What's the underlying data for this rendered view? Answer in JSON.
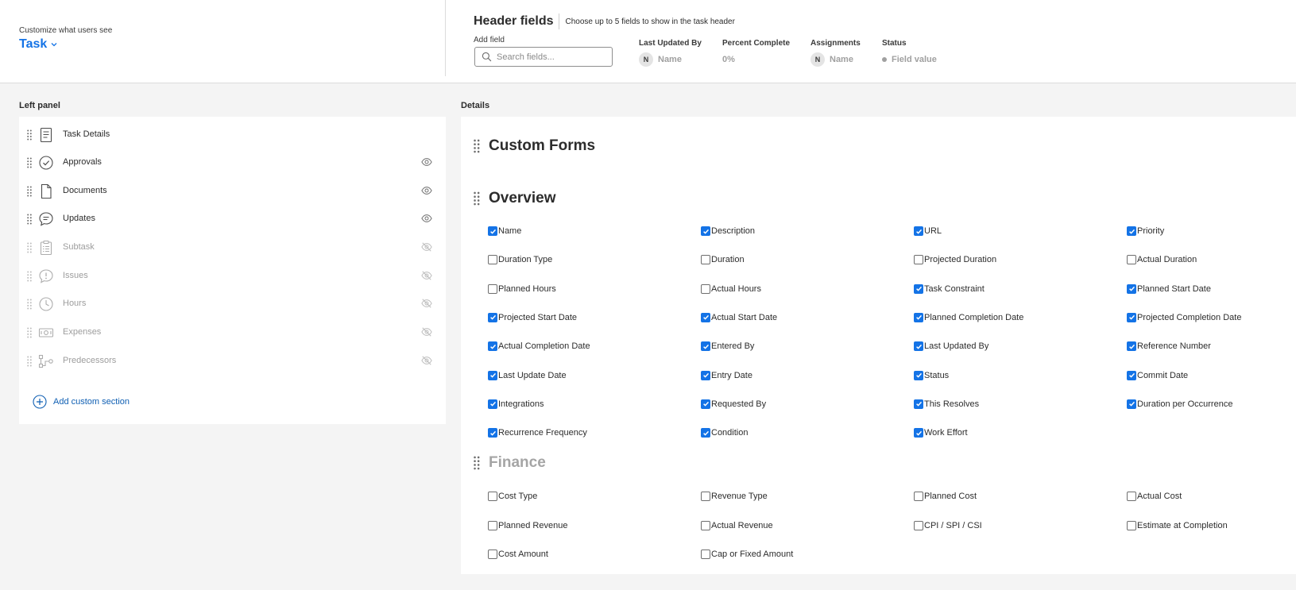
{
  "header": {
    "customize_label": "Customize what users see",
    "object_type": "Task",
    "title": "Header fields",
    "subtitle": "Choose up to 5 fields to show in the task header",
    "add_field_label": "Add field",
    "search_placeholder": "Search fields...",
    "fields": [
      {
        "label": "Last Updated By",
        "value": "Name",
        "avatar": "N"
      },
      {
        "label": "Percent Complete",
        "value": "0%"
      },
      {
        "label": "Assignments",
        "value": "Name",
        "avatar": "N"
      },
      {
        "label": "Status",
        "value": "Field value"
      }
    ]
  },
  "left_panel": {
    "title": "Left panel",
    "items": [
      {
        "label": "Task Details",
        "icon": "document-lines-icon",
        "visible": true,
        "show_eye": false
      },
      {
        "label": "Approvals",
        "icon": "approval-check-icon",
        "visible": true,
        "show_eye": true
      },
      {
        "label": "Documents",
        "icon": "document-icon",
        "visible": true,
        "show_eye": true
      },
      {
        "label": "Updates",
        "icon": "chat-bubble-icon",
        "visible": true,
        "show_eye": true
      },
      {
        "label": "Subtask",
        "icon": "clipboard-list-icon",
        "visible": false,
        "show_eye": true
      },
      {
        "label": "Issues",
        "icon": "alert-bubble-icon",
        "visible": false,
        "show_eye": true
      },
      {
        "label": "Hours",
        "icon": "clock-icon",
        "visible": false,
        "show_eye": true
      },
      {
        "label": "Expenses",
        "icon": "money-icon",
        "visible": false,
        "show_eye": true
      },
      {
        "label": "Predecessors",
        "icon": "flow-icon",
        "visible": false,
        "show_eye": true
      }
    ],
    "add_custom_section": "Add custom section"
  },
  "details": {
    "title": "Details",
    "sections": {
      "custom_forms": "Custom Forms",
      "overview": "Overview",
      "finance": "Finance"
    },
    "overview_fields": [
      {
        "label": "Name",
        "checked": true
      },
      {
        "label": "Description",
        "checked": true
      },
      {
        "label": "URL",
        "checked": true
      },
      {
        "label": "Priority",
        "checked": true
      },
      {
        "label": "Duration Type",
        "checked": false
      },
      {
        "label": "Duration",
        "checked": false
      },
      {
        "label": "Projected Duration",
        "checked": false
      },
      {
        "label": "Actual Duration",
        "checked": false
      },
      {
        "label": "Planned Hours",
        "checked": false
      },
      {
        "label": "Actual Hours",
        "checked": false
      },
      {
        "label": "Task Constraint",
        "checked": true
      },
      {
        "label": "Planned Start Date",
        "checked": true
      },
      {
        "label": "Projected Start Date",
        "checked": true
      },
      {
        "label": "Actual Start Date",
        "checked": true
      },
      {
        "label": "Planned Completion Date",
        "checked": true
      },
      {
        "label": "Projected Completion Date",
        "checked": true
      },
      {
        "label": "Actual Completion Date",
        "checked": true
      },
      {
        "label": "Entered By",
        "checked": true
      },
      {
        "label": "Last Updated By",
        "checked": true
      },
      {
        "label": "Reference Number",
        "checked": true
      },
      {
        "label": "Last Update Date",
        "checked": true
      },
      {
        "label": "Entry Date",
        "checked": true
      },
      {
        "label": "Status",
        "checked": true
      },
      {
        "label": "Commit Date",
        "checked": true
      },
      {
        "label": "Integrations",
        "checked": true
      },
      {
        "label": "Requested By",
        "checked": true
      },
      {
        "label": "This Resolves",
        "checked": true
      },
      {
        "label": "Duration per Occurrence",
        "checked": true
      },
      {
        "label": "Recurrence Frequency",
        "checked": true
      },
      {
        "label": "Condition",
        "checked": true
      },
      {
        "label": "Work Effort",
        "checked": true
      }
    ],
    "finance_fields": [
      {
        "label": "Cost Type",
        "checked": false
      },
      {
        "label": "Revenue Type",
        "checked": false
      },
      {
        "label": "Planned Cost",
        "checked": false
      },
      {
        "label": "Actual Cost",
        "checked": false
      },
      {
        "label": "Planned Revenue",
        "checked": false
      },
      {
        "label": "Actual Revenue",
        "checked": false
      },
      {
        "label": "CPI / SPI / CSI",
        "checked": false
      },
      {
        "label": "Estimate at Completion",
        "checked": false
      },
      {
        "label": "Cost Amount",
        "checked": false
      },
      {
        "label": "Cap or Fixed Amount",
        "checked": false
      }
    ]
  },
  "colors": {
    "accent": "#1473e6",
    "link": "#0f5fb3",
    "panel_bg": "#f4f4f4"
  }
}
